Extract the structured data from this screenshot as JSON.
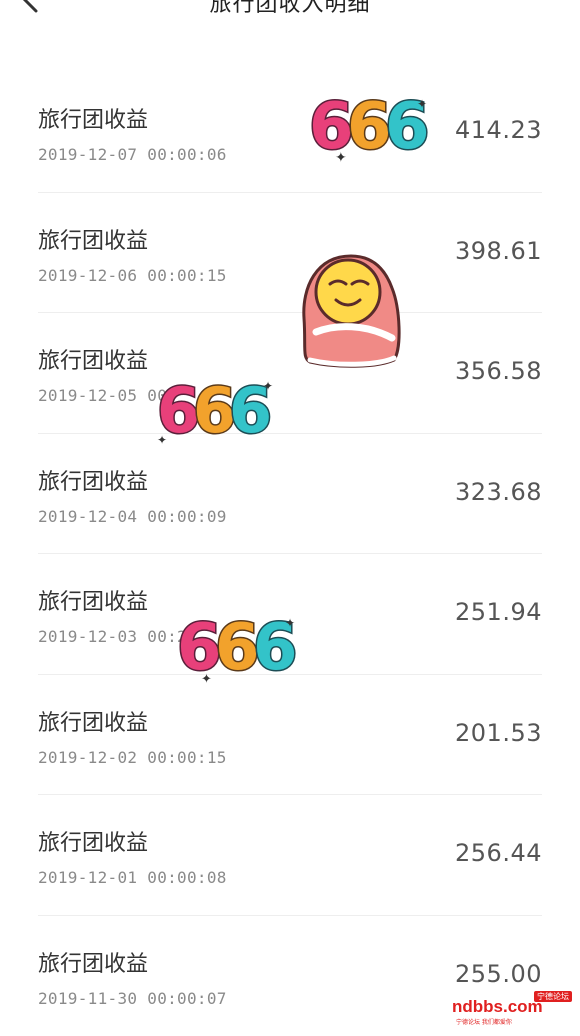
{
  "header": {
    "back_icon": "chevron-left-icon",
    "title": "旅行团收入明细"
  },
  "records": [
    {
      "title": "旅行团收益",
      "time": "2019-12-07 00:00:06",
      "amount": "414.23"
    },
    {
      "title": "旅行团收益",
      "time": "2019-12-06 00:00:15",
      "amount": "398.61"
    },
    {
      "title": "旅行团收益",
      "time": "2019-12-05 00",
      "amount": "356.58"
    },
    {
      "title": "旅行团收益",
      "time": "2019-12-04 00:00:09",
      "amount": "323.68"
    },
    {
      "title": "旅行团收益",
      "time": "2019-12-03 00:2",
      "amount": "251.94"
    },
    {
      "title": "旅行团收益",
      "time": "2019-12-02 00:00:15",
      "amount": "201.53"
    },
    {
      "title": "旅行团收益",
      "time": "2019-12-01 00:00:08",
      "amount": "256.44"
    },
    {
      "title": "旅行团收益",
      "time": "2019-11-30 00:00:07",
      "amount": "255.00"
    }
  ],
  "stickers": {
    "text_666": "666",
    "face": "smiling-face-blanket-sticker"
  },
  "watermark": {
    "main": "ndbbs.com",
    "badge": "宁德论坛",
    "sub": "宁德论坛 我们都爱你"
  },
  "colors": {
    "background": "#ffffff",
    "text_primary": "#333333",
    "text_secondary": "#8a8a8a",
    "divider": "#eeeeee",
    "watermark": "#e02020"
  }
}
